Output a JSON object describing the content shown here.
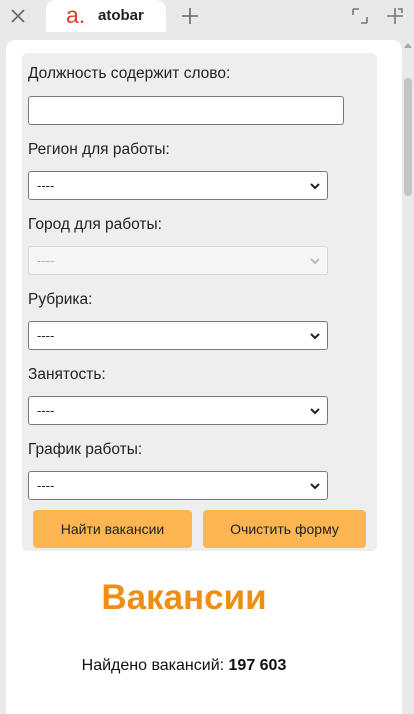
{
  "browser": {
    "tab_title": "atobar",
    "favicon_letter": "a."
  },
  "form": {
    "keyword": {
      "label": "Должность содержит слово:",
      "value": ""
    },
    "region": {
      "label": "Регион для работы:",
      "selected": "----"
    },
    "city": {
      "label": "Город для работы:",
      "selected": "----",
      "disabled": true
    },
    "category": {
      "label": "Рубрика:",
      "selected": "----"
    },
    "employment": {
      "label": "Занятость:",
      "selected": "----"
    },
    "schedule": {
      "label": "График работы:",
      "selected": "----"
    },
    "search_button": "Найти вакансии",
    "clear_button": "Очистить форму"
  },
  "results": {
    "heading": "Вакансии",
    "found_label": "Найдено вакансий:",
    "found_count": "197 603"
  },
  "colors": {
    "accent_orange": "#ee8f13",
    "button_orange": "#fcb551",
    "favicon_red": "#e8392d",
    "form_panel_bg": "#eeeeee"
  }
}
